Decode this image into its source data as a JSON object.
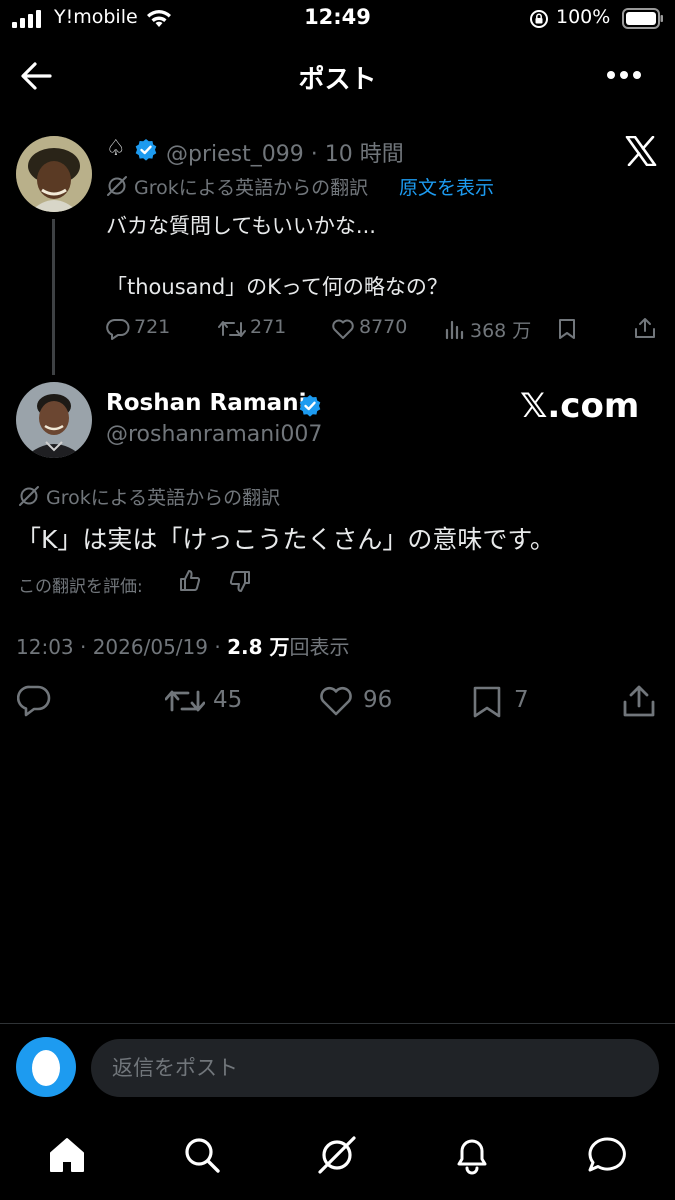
{
  "status_bar": {
    "carrier": "Y!mobile",
    "time": "12:49",
    "battery": "100%"
  },
  "header": {
    "title": "ポスト"
  },
  "parent_post": {
    "name_glyph": "♤",
    "handle": "@priest_099",
    "separator": "·",
    "time": "10 時間",
    "translation_label": "Grokによる英語からの翻訳",
    "show_original": "原文を表示",
    "text_line1": "バカな質問してもいいかな...",
    "text_line2": "「thousand」のKって何の略なの？",
    "replies": "721",
    "reposts": "271",
    "likes": "8770",
    "views": "368 万"
  },
  "main_post": {
    "name": "Roshan Ramani",
    "handle": "@roshanramani007",
    "watermark": "𝕏.com",
    "translation_label": "Grokによる英語からの翻訳",
    "text": "「K」は実は「けっこうたくさん」の意味です。",
    "rate_label": "この翻訳を評価:",
    "timestamp": "12:03 · 2026/05/19 · ",
    "views_count": "2.8 万",
    "views_label": "回表示",
    "reposts": "45",
    "likes": "96",
    "bookmarks": "7"
  },
  "reply_bar": {
    "placeholder": "返信をポスト"
  },
  "colors": {
    "background": "#000000",
    "accent": "#1d9bf0",
    "muted": "#71767b",
    "text": "#e7e9ea"
  }
}
